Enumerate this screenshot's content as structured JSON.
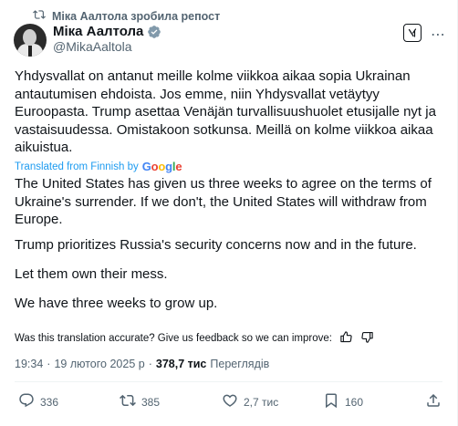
{
  "repost_label": "Міка Аалтола зробила репост",
  "author": {
    "name": "Міка Аалтола",
    "handle": "@MikaAaltola"
  },
  "original_text": "Yhdysvallat on antanut meille kolme viikkoa aikaa sopia Ukrainan antautumisen ehdoista. Jos emme, niin Yhdysvallat vetäytyy Euroopasta. Trump asettaa Venäjän turvallisuushuolet etusijalle nyt ja vastaisuudessa. Omistakoon sotkunsa. Meillä on kolme viikkoa aikaa aikuistua.",
  "translated_from": "Translated from Finnish by",
  "translation": [
    "The United States has given us three weeks to agree on the terms of Ukraine's surrender. If we don't, the United States will withdraw from Europe.",
    "Trump prioritizes Russia's security concerns now and in the future.",
    "Let them own their mess.",
    "We have three weeks to grow up."
  ],
  "feedback_prompt": "Was this translation accurate? Give us feedback so we can improve:",
  "meta": {
    "time": "19:34",
    "date": "19 лютого 2025 р",
    "views": "378,7 тис",
    "views_label": "Переглядів"
  },
  "actions": {
    "replies": "336",
    "reposts": "385",
    "likes": "2,7 тис",
    "bookmarks": "160"
  },
  "icons": [
    "repost-icon",
    "verified-icon",
    "grok-icon",
    "more-icon",
    "thumbs-up-icon",
    "thumbs-down-icon",
    "reply-icon",
    "heart-icon",
    "bookmark-icon",
    "share-icon"
  ],
  "colors": {
    "link": "#1d9bf0",
    "muted": "#536471",
    "text": "#0f1419"
  }
}
